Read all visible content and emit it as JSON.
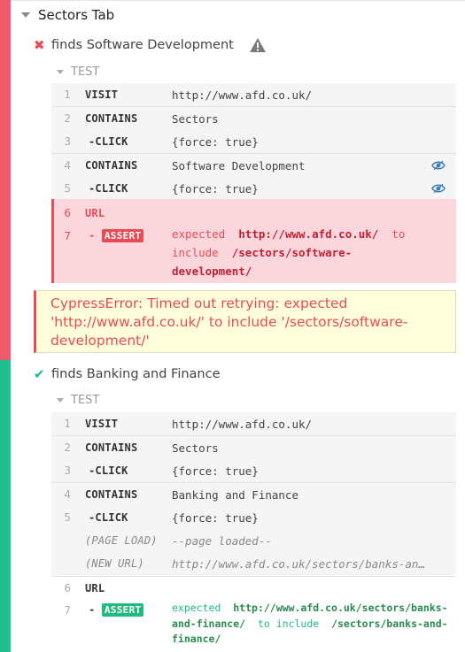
{
  "suite": {
    "title": "Sectors Tab"
  },
  "tests": [
    {
      "title": "finds Software Development",
      "state": "failed",
      "section_label": "TEST",
      "commands": [
        {
          "num": "1",
          "name": "VISIT",
          "message": "http://www.afd.co.uk/"
        },
        {
          "num": "2",
          "name": "CONTAINS",
          "message": "Sectors"
        },
        {
          "num": "3",
          "name": "-CLICK",
          "message": "{force: true}"
        },
        {
          "num": "4",
          "name": "CONTAINS",
          "message": "Software Development"
        },
        {
          "num": "5",
          "name": "-CLICK",
          "message": "{force: true}"
        },
        {
          "num": "6",
          "name": "URL",
          "message": ""
        },
        {
          "num": "7",
          "name_prefix": "-",
          "badge": "ASSERT",
          "msg_parts": [
            "expected",
            "http://www.afd.co.uk/",
            "to",
            "include",
            "/sectors/software-",
            "development/"
          ]
        }
      ],
      "error": "CypressError: Timed out retrying: expected 'http://www.afd.co.uk/' to include '/sectors/software-development/'"
    },
    {
      "title": "finds Banking and Finance",
      "state": "passed",
      "section_label": "TEST",
      "commands": [
        {
          "num": "1",
          "name": "VISIT",
          "message": "http://www.afd.co.uk/"
        },
        {
          "num": "2",
          "name": "CONTAINS",
          "message": "Sectors"
        },
        {
          "num": "3",
          "name": "-CLICK",
          "message": "{force: true}"
        },
        {
          "num": "4",
          "name": "CONTAINS",
          "message": "Banking and Finance"
        },
        {
          "num": "5",
          "name": "-CLICK",
          "message": "{force: true}"
        },
        {
          "num": "",
          "name": "(PAGE LOAD)",
          "message": "--page loaded--"
        },
        {
          "num": "",
          "name": "(NEW URL)",
          "message": "http://www.afd.co.uk/sectors/banks-an…"
        },
        {
          "num": "6",
          "name": "URL",
          "message": ""
        },
        {
          "num": "7",
          "name_prefix": "-",
          "badge": "ASSERT",
          "msg_parts": [
            "expected",
            "http://www.afd.co.uk/sectors/banks-",
            "and-finance/",
            "to include",
            "/sectors/banks-and-",
            "finance/"
          ]
        }
      ]
    }
  ],
  "icons": {
    "fail": "x-icon",
    "pass": "check-icon",
    "warning": "warning-icon",
    "pinned": "eye-icon"
  },
  "colors": {
    "fail": "#e94b55",
    "pass": "#1fb981",
    "error_bg": "#ffffdc",
    "failed_cmd_bg": "#fbd6dc"
  }
}
